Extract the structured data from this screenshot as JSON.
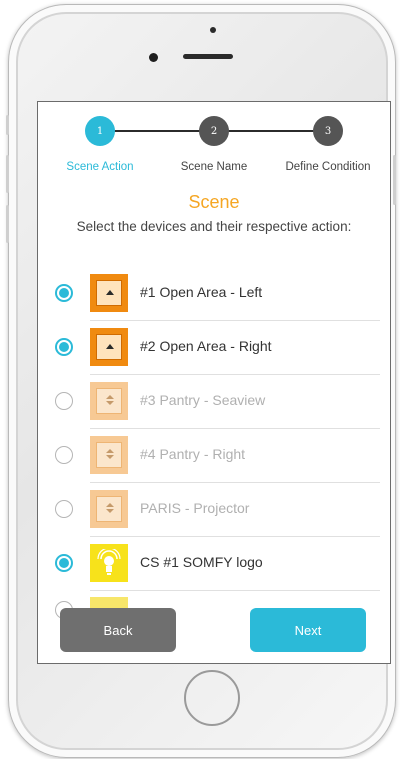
{
  "stepper": {
    "steps": [
      {
        "number": "1",
        "label": "Scene Action",
        "state": "active"
      },
      {
        "number": "2",
        "label": "Scene Name",
        "state": "inactive"
      },
      {
        "number": "3",
        "label": "Define Condition",
        "state": "inactive"
      }
    ]
  },
  "page": {
    "title": "Scene",
    "subtitle": "Select the devices and their respective action:"
  },
  "devices": [
    {
      "label": "#1 Open Area - Left",
      "selected": true,
      "icon": "shade-icon"
    },
    {
      "label": "#2 Open Area - Right",
      "selected": true,
      "icon": "shade-icon"
    },
    {
      "label": "#3 Pantry - Seaview",
      "selected": false,
      "icon": "shade-icon"
    },
    {
      "label": "#4 Pantry - Right",
      "selected": false,
      "icon": "shade-icon"
    },
    {
      "label": "PARIS - Projector",
      "selected": false,
      "icon": "shade-icon"
    },
    {
      "label": "CS #1 SOMFY logo",
      "selected": true,
      "icon": "light-bulb-icon"
    }
  ],
  "buttons": {
    "back_label": "Back",
    "next_label": "Next"
  },
  "colors": {
    "accent": "#2bbad8",
    "title": "#f5a623",
    "back_button": "#6f6f6f",
    "shade_active": "#f08a10",
    "bulb": "#f7e21b"
  }
}
